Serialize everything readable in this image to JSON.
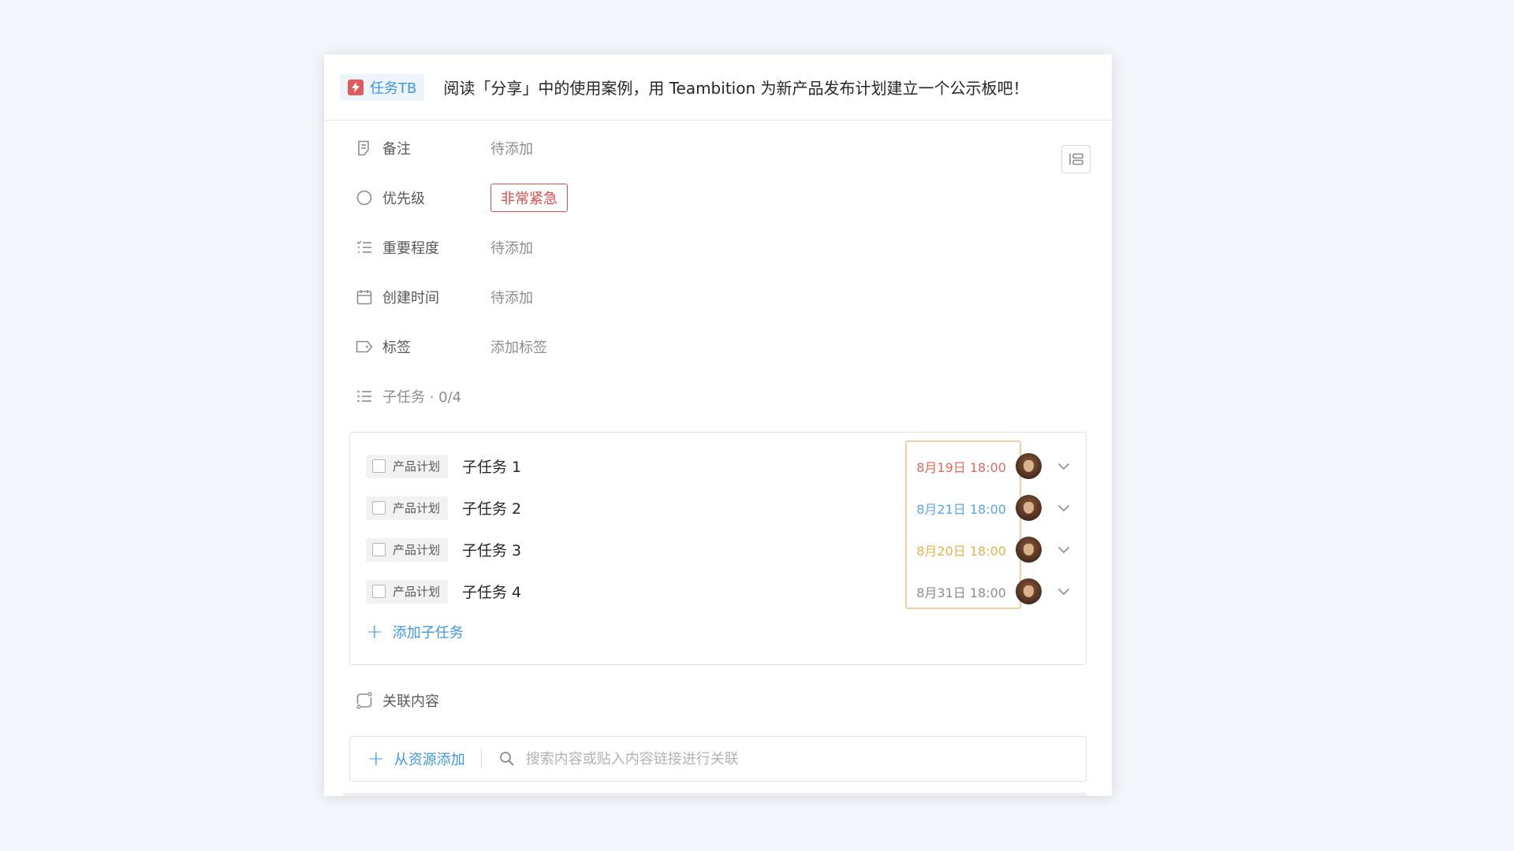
{
  "header": {
    "badge_label": "任务TB",
    "badge_icon": "lightning-icon",
    "title": "阅读「分享」中的使用案例，用 Teambition 为新产品发布计划建立一个公示板吧！"
  },
  "fields": {
    "note": {
      "label": "备注",
      "value": "待添加",
      "icon": "note-icon"
    },
    "priority": {
      "label": "优先级",
      "value": "非常紧急",
      "icon": "circle-icon",
      "color": "#e24b4b"
    },
    "importance": {
      "label": "重要程度",
      "value": "待添加",
      "icon": "list-icon"
    },
    "created": {
      "label": "创建时间",
      "value": "待添加",
      "icon": "calendar-icon"
    },
    "tags": {
      "label": "标签",
      "value": "添加标签",
      "icon": "tag-icon"
    }
  },
  "subtasks": {
    "header": "子任务 · 0/4",
    "items": [
      {
        "project": "产品计划",
        "title": "子任务 1",
        "due": "8月19日 18:00",
        "due_color": "#e06a5a"
      },
      {
        "project": "产品计划",
        "title": "子任务 2",
        "due": "8月21日 18:00",
        "due_color": "#5aa6e8"
      },
      {
        "project": "产品计划",
        "title": "子任务 3",
        "due": "8月20日 18:00",
        "due_color": "#e8b24a"
      },
      {
        "project": "产品计划",
        "title": "子任务 4",
        "due": "8月31日 18:00",
        "due_color": "#8c8c8c"
      }
    ],
    "add_label": "添加子任务"
  },
  "related": {
    "label": "关联内容",
    "add_from_resource": "从资源添加",
    "search_placeholder": "搜索内容或贴入内容链接进行关联"
  },
  "colors": {
    "accent": "#3c97e6",
    "urgent": "#e24b4b",
    "highlight_border": "#f4cf9e"
  }
}
